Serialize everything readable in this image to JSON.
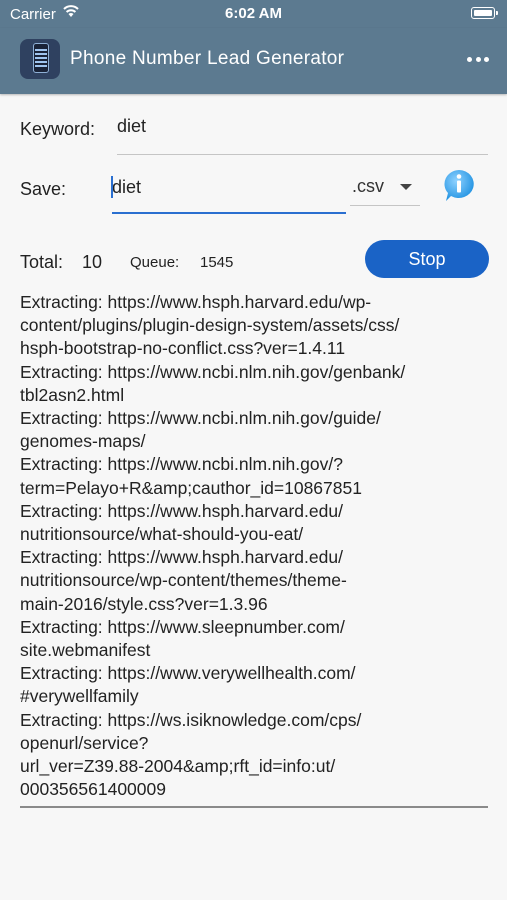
{
  "status_bar": {
    "carrier": "Carrier",
    "time": "6:02 AM"
  },
  "app": {
    "title": "Phone Number Lead Generator",
    "accent": "#5c7a90"
  },
  "form": {
    "keyword_label": "Keyword:",
    "keyword_value": "diet",
    "save_label": "Save:",
    "save_value": "diet",
    "ext_value": ".csv"
  },
  "stats": {
    "total_label": "Total:",
    "total_value": "10",
    "queue_label": "Queue:",
    "queue_value": "1545"
  },
  "stop_button": {
    "label": "Stop",
    "color": "#1a63c6"
  },
  "log": [
    "Extracting: https://www.hsph.harvard.edu/wp-",
    "content/plugins/plugin-design-system/assets/css/",
    "hsph-bootstrap-no-conflict.css?ver=1.4.11",
    "Extracting: https://www.ncbi.nlm.nih.gov/genbank/",
    "tbl2asn2.html",
    "Extracting: https://www.ncbi.nlm.nih.gov/guide/",
    "genomes-maps/",
    "Extracting: https://www.ncbi.nlm.nih.gov/?",
    "term=Pelayo+R&amp;cauthor_id=10867851",
    "Extracting: https://www.hsph.harvard.edu/",
    "nutritionsource/what-should-you-eat/",
    "Extracting: https://www.hsph.harvard.edu/",
    "nutritionsource/wp-content/themes/theme-",
    "main-2016/style.css?ver=1.3.96",
    "Extracting: https://www.sleepnumber.com/",
    "site.webmanifest",
    "Extracting: https://www.verywellhealth.com/",
    "#verywellfamily",
    "Extracting: https://ws.isiknowledge.com/cps/",
    "openurl/service?",
    "url_ver=Z39.88-2004&amp;rft_id=info:ut/",
    "000356561400009"
  ]
}
